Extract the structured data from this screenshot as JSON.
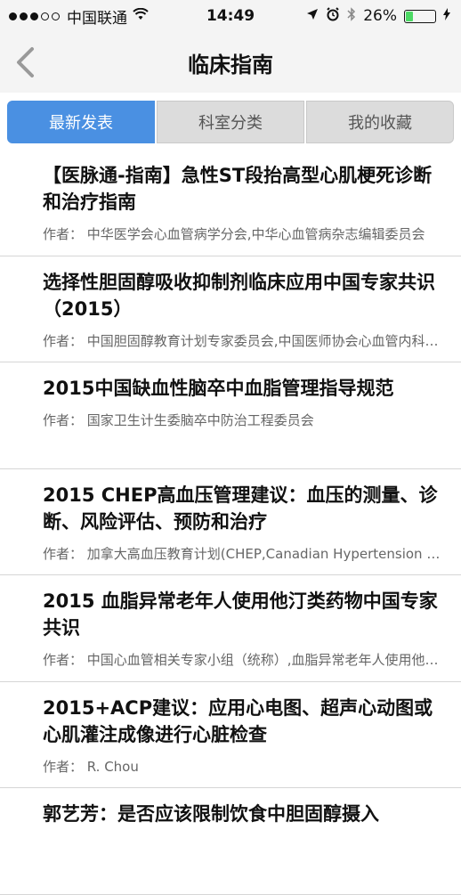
{
  "status_bar": {
    "carrier": "中国联通",
    "time": "14:49",
    "battery_percent": "26%",
    "battery_level": 0.26,
    "signal_bars_filled": 3,
    "signal_bars_total": 5,
    "icons": [
      "wifi-icon",
      "location-icon",
      "alarm-icon",
      "bluetooth-icon",
      "battery-icon",
      "charging-icon"
    ]
  },
  "nav": {
    "title": "临床指南",
    "back_icon": "chevron-left-icon"
  },
  "tabs": [
    {
      "label": "最新发表",
      "active": true
    },
    {
      "label": "科室分类",
      "active": false
    },
    {
      "label": "我的收藏",
      "active": false
    }
  ],
  "articles": [
    {
      "title": "【医脉通-指南】急性ST段抬高型心肌梗死诊断和治疗指南",
      "author": "作者：  中华医学会心血管病学分会,中华心血管病杂志编辑委员会"
    },
    {
      "title": "选择性胆固醇吸收抑制剂临床应用中国专家共识（2015）",
      "author": "作者：  中国胆固醇教育计划专家委员会,中国医师协会心血管内科医师分会"
    },
    {
      "title": "2015中国缺血性脑卒中血脂管理指导规范",
      "author": "作者：  国家卫生计生委脑卒中防治工程委员会"
    },
    {
      "title": "2015 CHEP高血压管理建议：血压的测量、诊断、风险评估、预防和治疗",
      "author": "作者：  加拿大高血压教育计划(CHEP,Canadian Hypertension Education Program)"
    },
    {
      "title": "2015 血脂异常老年人使用他汀类药物中国专家共识",
      "author": "作者：  中国心血管相关专家小组（统称）,血脂异常老年人使用他汀类药物中国专家共识组"
    },
    {
      "title": "2015+ACP建议：应用心电图、超声心动图或心肌灌注成像进行心脏检查",
      "author": "作者：  R. Chou"
    },
    {
      "title": "郭艺芳：是否应该限制饮食中胆固醇摄入",
      "author": ""
    }
  ],
  "colors": {
    "accent": "#4a90e2",
    "bar_bg": "#f4f4f4",
    "tab_inactive": "#dcdcdc",
    "divider": "#d6d6d6",
    "battery": "#4cd964"
  }
}
